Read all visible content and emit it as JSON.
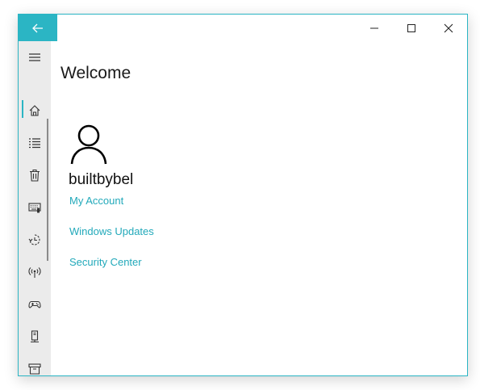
{
  "titlebar": {
    "back_icon": "arrow-left-icon",
    "minimize_icon": "minimize-icon",
    "maximize_icon": "maximize-icon",
    "close_icon": "close-icon"
  },
  "sidebar": {
    "menu_icon": "hamburger-menu-icon",
    "items": [
      {
        "icon": "home-icon",
        "selected": true
      },
      {
        "icon": "list-icon"
      },
      {
        "icon": "trash-icon"
      },
      {
        "icon": "keyboard-icon"
      },
      {
        "icon": "history-icon"
      },
      {
        "icon": "wireless-icon"
      },
      {
        "icon": "gamepad-icon"
      },
      {
        "icon": "tower-icon"
      },
      {
        "icon": "archive-icon"
      }
    ]
  },
  "main": {
    "title": "Welcome",
    "username": "builtbybel",
    "links": [
      {
        "label": "My Account"
      },
      {
        "label": "Windows Updates"
      },
      {
        "label": "Security Center"
      }
    ]
  },
  "colors": {
    "accent": "#2bb5c4",
    "link": "#22a9ba",
    "sidebar_bg": "#ebebeb"
  }
}
